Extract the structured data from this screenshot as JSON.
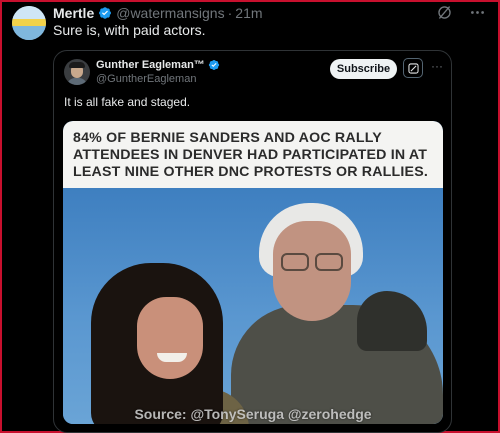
{
  "post": {
    "author_name": "Mertle",
    "author_handle": "@watermansigns",
    "separator": "·",
    "timestamp": "21m",
    "text": "Sure is, with paid actors."
  },
  "quoted_post": {
    "author_name": "Gunther Eagleman™",
    "author_handle": "@GuntherEagleman",
    "subscribe_label": "Subscribe",
    "more_label": "···",
    "text": "It is all fake and staged.",
    "image_headline": "84% OF BERNIE SANDERS AND AOC RALLY ATTENDEES IN DENVER HAD PARTICIPATED IN AT LEAST NINE OTHER DNC PROTESTS OR RALLIES.",
    "image_credit": "Source: @TonySeruga @zerohedge"
  },
  "icons": {
    "verified": "verified-badge-icon",
    "grok": "grok-icon",
    "more": "more-icon"
  },
  "colors": {
    "background": "#000000",
    "verified_blue": "#1d9bf0",
    "muted_text": "#71767b",
    "frame_border": "#c8102e"
  }
}
